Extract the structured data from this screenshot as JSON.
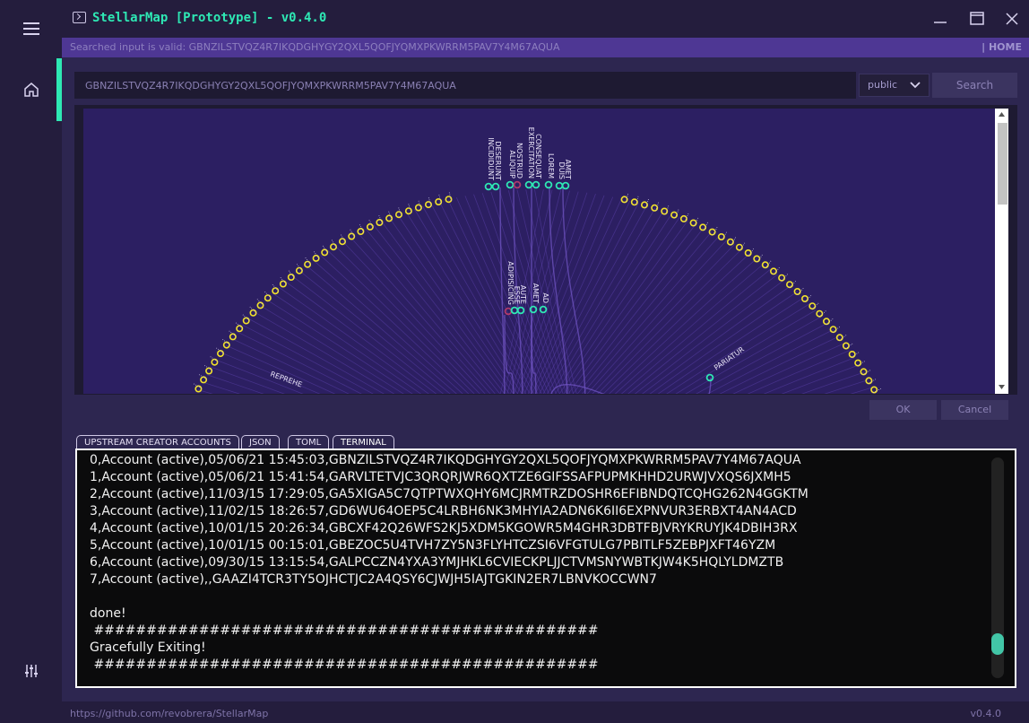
{
  "window": {
    "title": "StellarMap [Prototype] - v0.4.0"
  },
  "status": {
    "message": "Searched input is valid: GBNZILSTVQZ4R7IKQDGHYGY2QXL5QOFJYQMXPKWRRM5PAV7Y4M67AQUA",
    "home_link": "| HOME"
  },
  "search": {
    "value": "GBNZILSTVQZ4R7IKQDGHYGY2QXL5QOFJYQMXPKWRRM5PAV7Y4M67AQUA",
    "network": "public",
    "button": "Search"
  },
  "graph": {
    "labels_center": [
      "INCIDIDUNT",
      "DESERUNT",
      "ALIQUIP",
      "NOSTRUD",
      "EXERCITATION",
      "CONSEQUAT",
      "LOREM",
      "DUIS",
      "AMET",
      "ADIPISICING",
      "ESSE",
      "AUTE",
      "AMET",
      "AD",
      "PARIATUR",
      "REPREHE"
    ],
    "colors": {
      "teal": "#2ee8b4",
      "yellow": "#f2e22a",
      "magenta": "#b03a6a"
    }
  },
  "dialog": {
    "ok": "OK",
    "cancel": "Cancel"
  },
  "tabs": [
    {
      "label": "UPSTREAM CREATOR ACCOUNTS"
    },
    {
      "label": "JSON"
    },
    {
      "label": "TOML"
    },
    {
      "label": "TERMINAL"
    }
  ],
  "terminal": {
    "lines": [
      "0,Account (active),05/06/21 15:45:03,GBNZILSTVQZ4R7IKQDGHYGY2QXL5QOFJYQMXPKWRRM5PAV7Y4M67AQUA",
      "1,Account (active),05/06/21 15:41:54,GARVLTETVJC3QRQRJWR6QXTZE6GIFSSAFPUPMKHHD2URWJVXQS6JXMH5",
      "2,Account (active),11/03/15 17:29:05,GA5XIGA5C7QTPTWXQHY6MCJRMTRZDOSHR6EFIBNDQTCQHG262N4GGKTM",
      "3,Account (active),11/02/15 18:26:57,GD6WU64OEP5C4LRBH6NK3MHYIA2ADN6K6II6EXPNVUR3ERBXT4AN4ACD",
      "4,Account (active),10/01/15 20:26:34,GBCXF42Q26WFS2KJ5XDM5KGOWR5M4GHR3DBTFBJVRYKRUYJK4DBIH3RX",
      "5,Account (active),10/01/15 00:15:01,GBEZOC5U4TVH7ZY5N3FLYHTCZSI6VFGTULG7PBITLF5ZEBPJXFT46YZM",
      "6,Account (active),09/30/15 13:15:54,GALPCCZN4YXA3YMJHKL6CVIECKPLJJCTVMSNYWBTKJW4K5HQLYLDMZTB",
      "7,Account (active),,GAAZI4TCR3TY5OJHCTJC2A4QSY6CJWJH5IAJTGKIN2ER7LBNVKOCCWN7",
      "",
      "done!",
      " ################################################",
      "Gracefully Exiting!",
      " ################################################"
    ]
  },
  "footer": {
    "url": "https://github.com/revobrera/StellarMap",
    "version": "v0.4.0"
  }
}
